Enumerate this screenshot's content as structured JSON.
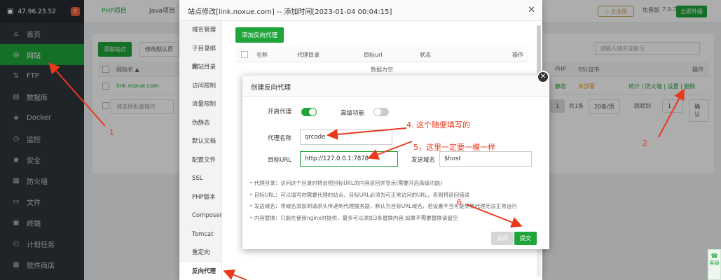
{
  "sidebar": {
    "server_ip": "47.96.23.52",
    "badge": "0",
    "items": [
      {
        "icon": "home-icon",
        "label": "首页"
      },
      {
        "icon": "globe-icon",
        "label": "网站"
      },
      {
        "icon": "ftp-icon",
        "label": "FTP"
      },
      {
        "icon": "database-icon",
        "label": "数据库"
      },
      {
        "icon": "docker-icon",
        "label": "Docker"
      },
      {
        "icon": "monitor-icon",
        "label": "监控"
      },
      {
        "icon": "shield-icon",
        "label": "安全"
      },
      {
        "icon": "firewall-icon",
        "label": "防火墙"
      },
      {
        "icon": "folder-icon",
        "label": "文件"
      },
      {
        "icon": "terminal-icon",
        "label": "终端"
      },
      {
        "icon": "clock-icon",
        "label": "计划任务"
      },
      {
        "icon": "store-icon",
        "label": "软件商店"
      }
    ],
    "active_index": 1
  },
  "topbar": {
    "tabs": [
      "PHP项目",
      "Java项目"
    ],
    "enterprise": "企业版",
    "free_label": "免费版",
    "version": "7.9.7",
    "upgrade": "立即升级"
  },
  "background": {
    "add_site": "添加站点",
    "modify_default": "修改默认页",
    "search_placeholder": "请输入域名或备注",
    "col_sitename": "网站名 ▲",
    "col_php": "PHP",
    "col_ssl": "SSL证书",
    "col_ops": "操作",
    "row_site": "link.noxue.com",
    "row_php": "静态",
    "row_ssl": "未部署",
    "row_actions": "统计 | 防火墙 | 设置 | 删除",
    "batch_placeholder": "请选择批量操作",
    "page": "1",
    "total": "共1条",
    "per_page": "20条/页",
    "goto": "跳转到",
    "goto_page": "1",
    "confirm": "确认"
  },
  "dialog": {
    "title": "站点修改[link.noxue.com] -- 添加时间[2023-01-04 00:04:15]",
    "side_items": [
      "域名管理",
      "子目录绑定",
      "网站目录",
      "访问限制",
      "流量限制",
      "伪静态",
      "默认文档",
      "配置文件",
      "SSL",
      "PHP版本",
      "Composer",
      "Tomcat",
      "重定向",
      "反向代理"
    ],
    "add_proxy": "添加反向代理",
    "col_name": "名称",
    "col_dir": "代理目录",
    "col_target": "目标url",
    "col_status": "状态",
    "col_ops": "操作",
    "empty": "数据为空"
  },
  "modal": {
    "title": "创建反向代理",
    "enable_label": "开启代理",
    "advanced_label": "高级功能",
    "name_label": "代理名称",
    "name_value": "qrcode",
    "target_label": "目标URL",
    "target_value": "http://127.0.0.1:7878",
    "domain_label": "发送域名",
    "domain_value": "$host",
    "notes": [
      "代理目录：访问这个目录时将会把目标URL的内容返回并显示(需要开启高级功能)",
      "目标URL：可以填写你需要代理的站点，目标URL必须为可正常访问的URL，否则将返回错误",
      "发送域名：将域名添加到请求头传递到代理服务器，默认为目标URL域名，若设置不当可能导致代理无法正常运行",
      "内容替换：只能在使用nginx时提供，最多可以添加3条替换内容,如果不需要替换请留空"
    ],
    "close": "关闭",
    "submit": "提交"
  },
  "annotations": {
    "a1": "1",
    "a2": "2",
    "a4": "4. 这个随便填写的",
    "a5": "5，这里一定要一模一样",
    "a6": "6"
  },
  "float_widget": "客服",
  "colors": {
    "accent": "#20a53a",
    "annotation": "#e8391d",
    "sidebar": "#2f353b"
  }
}
